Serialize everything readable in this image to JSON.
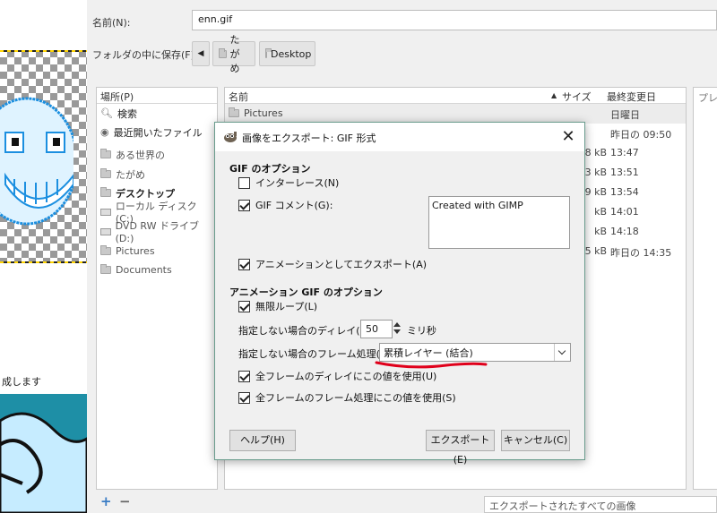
{
  "canvas": {
    "caption": "成します"
  },
  "save_dialog": {
    "name_label": "名前(N):",
    "name_value": "enn.gif",
    "folder_label": "フォルダの中に保存(F):",
    "breadcrumb": [
      "たがめ",
      "Desktop"
    ],
    "places_header": "場所(P)",
    "places": [
      {
        "label": "検索",
        "icon": "search-icon"
      },
      {
        "label": "最近開いたファイル",
        "icon": "recent-icon"
      },
      {
        "label": "ある世界の",
        "icon": "folder-icon"
      },
      {
        "label": "たがめ",
        "icon": "folder-icon"
      },
      {
        "label": "デスクトップ",
        "icon": "folder-icon"
      },
      {
        "label": "ローカル ディスク (C:)",
        "icon": "drive-icon"
      },
      {
        "label": "DVD RW ドライブ (D:)",
        "icon": "dvd-icon"
      },
      {
        "label": "Pictures",
        "icon": "folder-icon"
      },
      {
        "label": "Documents",
        "icon": "folder-icon"
      }
    ],
    "columns": {
      "name": "名前",
      "size": "サイズ",
      "modified": "最終変更日"
    },
    "files": [
      {
        "name": "Pictures",
        "size": "",
        "modified": "日曜日"
      },
      {
        "name": "",
        "size": "",
        "modified": "昨日の 09:50"
      },
      {
        "name": "",
        "size": "8 kB",
        "modified": "13:47"
      },
      {
        "name": "",
        "size": "3 kB",
        "modified": "13:51"
      },
      {
        "name": "",
        "size": "9 kB",
        "modified": "13:54"
      },
      {
        "name": "",
        "size": "kB",
        "modified": "14:01"
      },
      {
        "name": "",
        "size": "kB",
        "modified": "14:18"
      },
      {
        "name": "",
        "size": "5 kB",
        "modified": "昨日の 14:35"
      }
    ],
    "preview_label": "プレビ",
    "add_icon": "+",
    "remove_icon": "−",
    "filter_value": "エクスポートされたすべての画像"
  },
  "export_dialog": {
    "title": "画像をエクスポート: GIF 形式",
    "gif_options_title": "GIF のオプション",
    "interlace_label": "インターレース(N)",
    "interlace_checked": false,
    "gif_comment_label": "GIF コメント(G):",
    "gif_comment_checked": true,
    "comment_value": "Created with GIMP",
    "as_animation_label": "アニメーションとしてエクスポート(A)",
    "as_animation_checked": true,
    "anim_options_title": "アニメーション GIF のオプション",
    "loop_label": "無限ループ(L)",
    "loop_checked": true,
    "delay_label": "指定しない場合のディレイ(D):",
    "delay_value": "50",
    "delay_unit": "ミリ秒",
    "disposal_label": "指定しない場合のフレーム処理(F):",
    "disposal_value": "累積レイヤー (結合)",
    "use_delay_all_label": "全フレームのディレイにこの値を使用(U)",
    "use_delay_all_checked": true,
    "use_disposal_all_label": "全フレームのフレーム処理にこの値を使用(S)",
    "use_disposal_all_checked": true,
    "help_label": "ヘルプ(H)",
    "export_label": "エクスポート(E)",
    "cancel_label": "キャンセル(C)",
    "annotation_color": "#e0001b"
  }
}
